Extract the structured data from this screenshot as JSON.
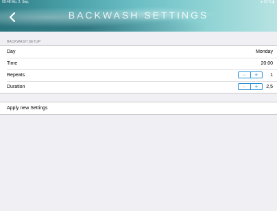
{
  "status_bar": {
    "time": "09:48",
    "date": "Mo. 2. Sep.",
    "battery": "18 %"
  },
  "header": {
    "title": "BACKWASH SETTINGS",
    "back_icon": "chevron-left-icon"
  },
  "backwash_setup": {
    "section_label": "BACKWASH SETUP",
    "rows": [
      {
        "label": "Day",
        "value": "Monday"
      },
      {
        "label": "Time",
        "value": "20:00"
      },
      {
        "label": "Repeats",
        "value": "1",
        "stepper": {
          "minus": "−",
          "plus": "+"
        }
      },
      {
        "label": "Duration",
        "value": "2,5",
        "stepper": {
          "minus": "−",
          "plus": "+"
        }
      }
    ]
  },
  "actions": {
    "apply_label": "Apply new Settings"
  },
  "colors": {
    "accent": "#2a8fd4",
    "background": "#efeff4"
  }
}
